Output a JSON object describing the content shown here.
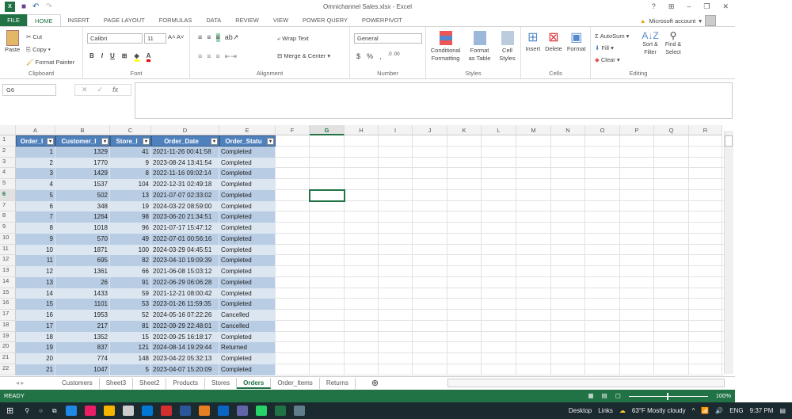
{
  "window": {
    "title": "Omnichannel Sales.xlsx - Excel",
    "controls": [
      "?",
      "⊞",
      "–",
      "❐",
      "✕"
    ]
  },
  "ribbon_tabs": [
    "FILE",
    "HOME",
    "INSERT",
    "PAGE LAYOUT",
    "FORMULAS",
    "DATA",
    "REVIEW",
    "VIEW",
    "POWER QUERY",
    "POWERPIVOT"
  ],
  "account": {
    "label": "Microsoft account"
  },
  "clipboard": {
    "paste": "Paste",
    "cut": "Cut",
    "copy": "Copy",
    "format_painter": "Format Painter",
    "label": "Clipboard"
  },
  "font": {
    "name": "Calibri",
    "size": "11",
    "bold": "B",
    "italic": "I",
    "underline": "U",
    "label": "Font"
  },
  "alignment": {
    "wrap": "Wrap Text",
    "merge": "Merge & Center",
    "label": "Alignment"
  },
  "number": {
    "format": "General",
    "currency": "$",
    "percent": "%",
    "comma": ",",
    "label": "Number"
  },
  "styles": {
    "conditional": "Conditional Formatting",
    "table": "Format as Table",
    "cell": "Cell Styles",
    "label": "Styles"
  },
  "cells": {
    "insert": "Insert",
    "delete": "Delete",
    "format": "Format",
    "label": "Cells"
  },
  "editing": {
    "autosum": "AutoSum",
    "fill": "Fill",
    "clear": "Clear",
    "sort": "Sort & Filter",
    "find": "Find & Select",
    "label": "Editing"
  },
  "formula_bar": {
    "name_box": "G6",
    "fx": "fx",
    "value": ""
  },
  "columns": [
    "A",
    "B",
    "C",
    "D",
    "E",
    "F",
    "G",
    "H",
    "I",
    "J",
    "K",
    "L",
    "M",
    "N",
    "O",
    "P",
    "Q",
    "R"
  ],
  "table": {
    "headers": [
      "Order_I",
      "Customer_I",
      "Store_I",
      "Order_Date",
      "Order_Statu"
    ],
    "rows": [
      [
        "1",
        "1329",
        "41",
        "2021-11-26 00:41:58",
        "Completed"
      ],
      [
        "2",
        "1770",
        "9",
        "2023-08-24 13:41:54",
        "Completed"
      ],
      [
        "3",
        "1429",
        "8",
        "2022-11-16 09:02:14",
        "Completed"
      ],
      [
        "4",
        "1537",
        "104",
        "2022-12-31 02:49:18",
        "Completed"
      ],
      [
        "5",
        "502",
        "13",
        "2021-07-07 02:33:02",
        "Completed"
      ],
      [
        "6",
        "348",
        "19",
        "2024-03-22 08:59:00",
        "Completed"
      ],
      [
        "7",
        "1264",
        "98",
        "2023-06-20 21:34:51",
        "Completed"
      ],
      [
        "8",
        "1018",
        "96",
        "2021-07-17 15:47:12",
        "Completed"
      ],
      [
        "9",
        "570",
        "49",
        "2022-07-01 00:56:16",
        "Completed"
      ],
      [
        "10",
        "1871",
        "100",
        "2024-03-29 04:45:51",
        "Completed"
      ],
      [
        "11",
        "695",
        "82",
        "2023-04-10 19:09:39",
        "Completed"
      ],
      [
        "12",
        "1361",
        "66",
        "2021-06-08 15:03:12",
        "Completed"
      ],
      [
        "13",
        "26",
        "91",
        "2022-06-29 06:06:28",
        "Completed"
      ],
      [
        "14",
        "1433",
        "59",
        "2021-12-21 08:00:42",
        "Completed"
      ],
      [
        "15",
        "1101",
        "53",
        "2023-01-26 11:59:35",
        "Completed"
      ],
      [
        "16",
        "1953",
        "52",
        "2024-05-16 07:22:26",
        "Cancelled"
      ],
      [
        "17",
        "217",
        "81",
        "2022-09-29 22:48:01",
        "Cancelled"
      ],
      [
        "18",
        "1352",
        "15",
        "2022-09-25 16:18:17",
        "Completed"
      ],
      [
        "19",
        "837",
        "121",
        "2024-08-14 19:29:44",
        "Returned"
      ],
      [
        "20",
        "774",
        "148",
        "2023-04-22 05:32:13",
        "Completed"
      ],
      [
        "21",
        "1047",
        "5",
        "2023-04-07 15:20:09",
        "Completed"
      ]
    ]
  },
  "sheets": [
    "Customers",
    "Sheet3",
    "Sheet2",
    "Products",
    "Stores",
    "Orders",
    "Order_Items",
    "Returns"
  ],
  "active_sheet": "Orders",
  "status": {
    "ready": "READY",
    "zoom": "100%"
  },
  "taskbar": {
    "desktop": "Desktop",
    "links": "Links",
    "weather": "63°F  Mostly cloudy",
    "lang": "ENG",
    "time": "9:37 PM"
  },
  "colors": {
    "excel_green": "#217346",
    "table_header": "#4f81bd",
    "band_dark": "#b8cce4",
    "band_light": "#dce6f1"
  }
}
